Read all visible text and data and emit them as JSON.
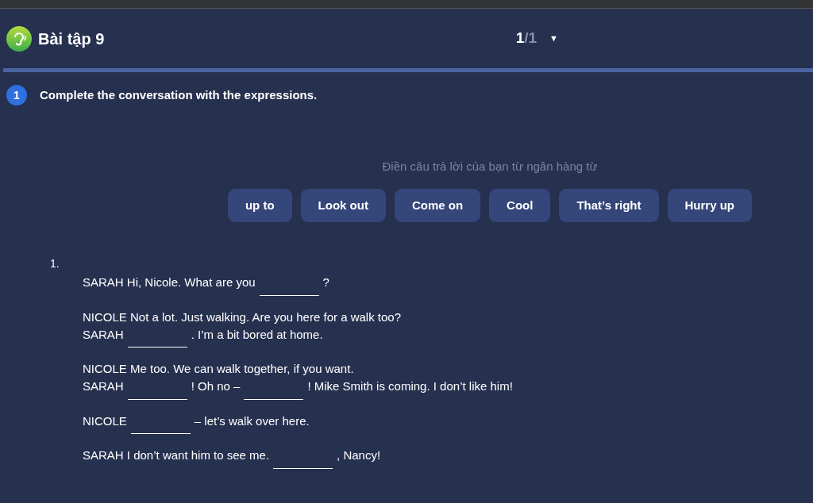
{
  "header": {
    "title": "Bài tập 9",
    "page_current": "1",
    "page_total": "/1",
    "dropdown": "▼"
  },
  "progress": {
    "level": 1
  },
  "question": {
    "number": "1",
    "text": "Complete the conversation with the expressions."
  },
  "word_bank": {
    "hint": "Điền câu trả lời của bạn từ ngân hàng từ",
    "words": [
      "up to",
      "Look out",
      "Come on",
      "Cool",
      "That’s right",
      "Hurry up"
    ]
  },
  "exercise": {
    "number": "1.",
    "paragraphs": [
      [
        [
          {
            "kind": "text",
            "text": "SARAH Hi, Nicole. What are you"
          },
          {
            "kind": "blank"
          },
          {
            "kind": "text",
            "text": "?"
          }
        ]
      ],
      [
        [
          {
            "kind": "text",
            "text": "NICOLE Not a lot. Just walking. Are you here for a walk too?"
          }
        ],
        [
          {
            "kind": "text",
            "text": "SARAH"
          },
          {
            "kind": "blank"
          },
          {
            "kind": "text",
            "text": ". I’m a bit bored at home."
          }
        ]
      ],
      [
        [
          {
            "kind": "text",
            "text": "NICOLE Me too. We can walk together, if you want."
          }
        ],
        [
          {
            "kind": "text",
            "text": "SARAH"
          },
          {
            "kind": "blank"
          },
          {
            "kind": "text",
            "text": "! Oh no –"
          },
          {
            "kind": "blank"
          },
          {
            "kind": "text",
            "text": "! Mike Smith is coming. I don’t like him!"
          }
        ]
      ],
      [
        [
          {
            "kind": "text",
            "text": "NICOLE"
          },
          {
            "kind": "blank"
          },
          {
            "kind": "text",
            "text": "– let’s walk over here."
          }
        ]
      ],
      [
        [
          {
            "kind": "text",
            "text": "SARAH I don’t want him to see me."
          },
          {
            "kind": "blank"
          },
          {
            "kind": "text",
            "text": ", Nancy!"
          }
        ]
      ]
    ]
  }
}
